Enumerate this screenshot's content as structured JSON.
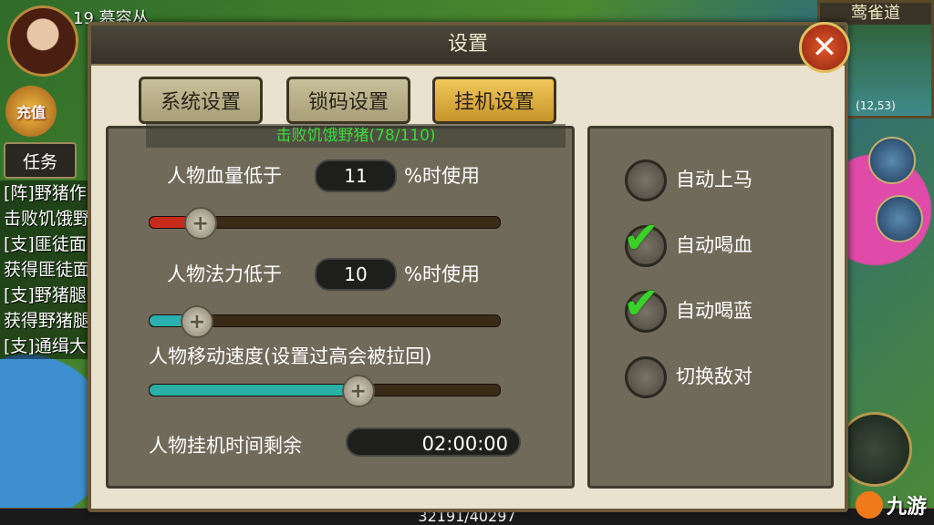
{
  "hud": {
    "level_name": "19 慕容丛",
    "recharge": "充值",
    "task_tab": "任务",
    "tasks": [
      "[阵]野猪作",
      "击败饥饿野",
      "[支]匪徒面",
      "获得匪徒面",
      "[支]野猪腿",
      "获得野猪腿",
      "[支]通缉大"
    ],
    "minimap_title": "莺雀道",
    "minimap_coord": "(12,53)",
    "exp": "32191/40297",
    "brand": "九游"
  },
  "dialog": {
    "title": "设置",
    "close": "✕",
    "tabs": [
      {
        "label": "系统设置",
        "active": false
      },
      {
        "label": "锁码设置",
        "active": false
      },
      {
        "label": "挂机设置",
        "active": true
      }
    ],
    "progress_banner": "击败饥饿野猪(78/110)"
  },
  "hang_settings": {
    "hp": {
      "label": "人物血量低于",
      "value": "11",
      "unit": "%时使用",
      "slider_fraction": 0.14
    },
    "mp": {
      "label": "人物法力低于",
      "value": "10",
      "unit": "%时使用",
      "slider_fraction": 0.13
    },
    "speed": {
      "label": "人物移动速度(设置过高会被拉回)",
      "slider_fraction": 0.59
    },
    "time": {
      "label": "人物挂机时间剩余",
      "value": "02:00:00"
    }
  },
  "options": [
    {
      "label": "自动上马",
      "checked": false
    },
    {
      "label": "自动喝血",
      "checked": true
    },
    {
      "label": "自动喝蓝",
      "checked": true
    },
    {
      "label": "切换敌对",
      "checked": false
    }
  ],
  "colors": {
    "hp_fill": "#c82a1a",
    "mp_fill": "#2ab0b0",
    "speed_fill": "#2ab0a8",
    "banner_text": "#3adc3a",
    "active_tab": "#e0b040"
  }
}
